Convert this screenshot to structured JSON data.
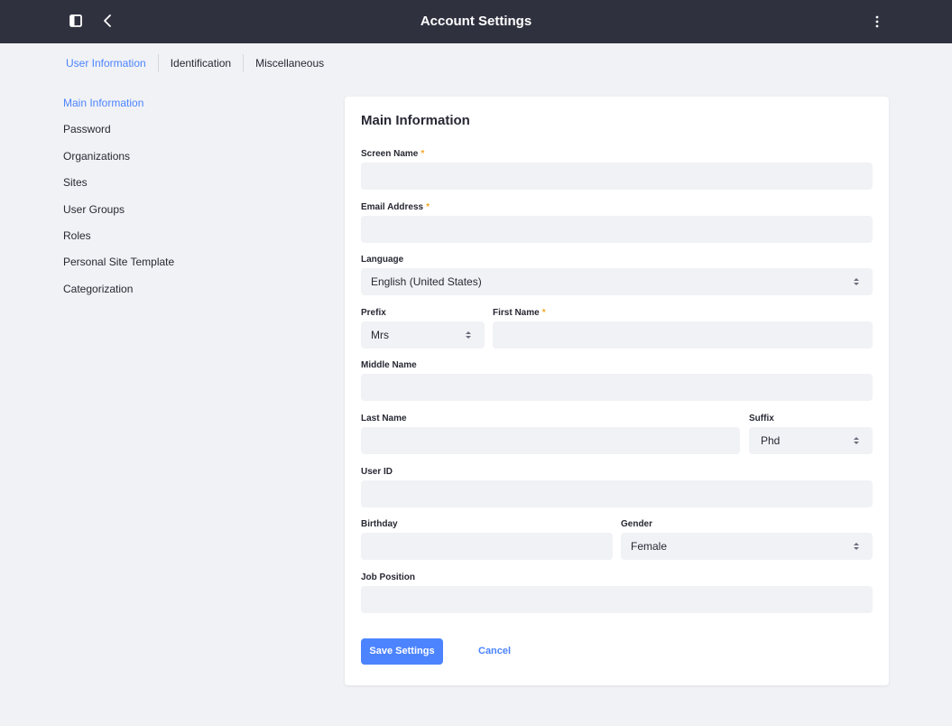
{
  "topbar": {
    "title": "Account Settings",
    "left_icons": [
      "panel-toggle-icon",
      "chevron-left-icon"
    ],
    "right_icon": "kebab-menu-icon"
  },
  "tabs": [
    {
      "label": "User Information",
      "active": true
    },
    {
      "label": "Identification",
      "active": false
    },
    {
      "label": "Miscellaneous",
      "active": false
    }
  ],
  "sidenav": {
    "items": [
      {
        "label": "Main Information",
        "active": true
      },
      {
        "label": "Password"
      },
      {
        "label": "Organizations"
      },
      {
        "label": "Sites"
      },
      {
        "label": "User Groups"
      },
      {
        "label": "Roles"
      },
      {
        "label": "Personal Site Template"
      },
      {
        "label": "Categorization"
      }
    ]
  },
  "form": {
    "title": "Main Information",
    "required_mark": "*",
    "screen_name": {
      "label": "Screen Name",
      "value": ""
    },
    "email": {
      "label": "Email Address",
      "value": ""
    },
    "language": {
      "label": "Language",
      "value": "English (United States)"
    },
    "prefix": {
      "label": "Prefix",
      "value": "Mrs"
    },
    "first_name": {
      "label": "First Name",
      "value": ""
    },
    "middle_name": {
      "label": "Middle Name",
      "value": ""
    },
    "last_name": {
      "label": "Last Name",
      "value": ""
    },
    "suffix": {
      "label": "Suffix",
      "value": "Phd"
    },
    "user_id": {
      "label": "User ID",
      "value": ""
    },
    "birthday": {
      "label": "Birthday",
      "value": ""
    },
    "gender": {
      "label": "Gender",
      "value": "Female"
    },
    "job_position": {
      "label": "Job Position",
      "value": ""
    },
    "save_label": "Save Settings",
    "cancel_label": "Cancel"
  },
  "colors": {
    "topbar": "#30313f",
    "accent": "#4c84ff",
    "background": "#f1f2f5",
    "required": "#f5a623"
  }
}
